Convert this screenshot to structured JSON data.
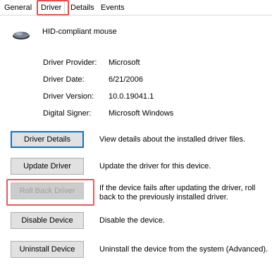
{
  "tabs": [
    {
      "label": "General"
    },
    {
      "label": "Driver"
    },
    {
      "label": "Details"
    },
    {
      "label": "Events"
    }
  ],
  "device": {
    "name": "HID-compliant mouse",
    "icon": "mouse-icon"
  },
  "properties": [
    {
      "label": "Driver Provider:",
      "value": "Microsoft"
    },
    {
      "label": "Driver Date:",
      "value": "6/21/2006"
    },
    {
      "label": "Driver Version:",
      "value": "10.0.19041.1"
    },
    {
      "label": "Digital Signer:",
      "value": "Microsoft Windows"
    }
  ],
  "actions": [
    {
      "button": "Driver Details",
      "description": "View details about the installed driver files."
    },
    {
      "button": "Update Driver",
      "description": "Update the driver for this device."
    },
    {
      "button": "Roll Back Driver",
      "description": "If the device fails after updating the driver, roll back to the previously installed driver."
    },
    {
      "button": "Disable Device",
      "description": "Disable the device."
    },
    {
      "button": "Uninstall Device",
      "description": "Uninstall the device from the system (Advanced)."
    }
  ],
  "colors": {
    "highlight": "#e74c4c",
    "focus": "#0078d7"
  }
}
